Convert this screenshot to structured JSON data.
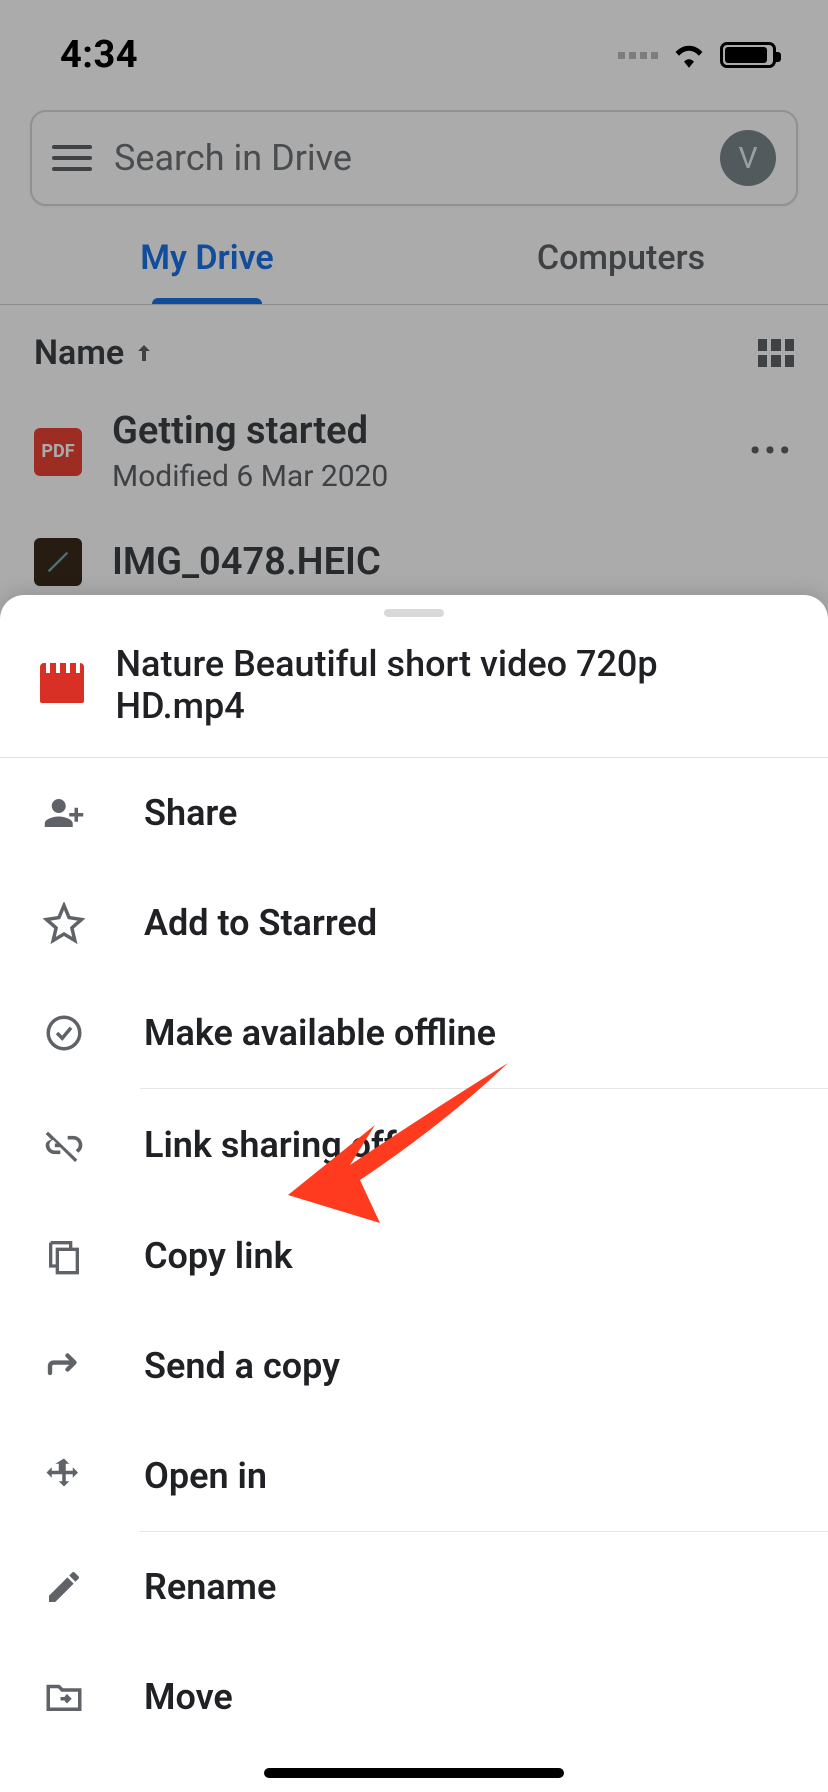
{
  "statusbar": {
    "time": "4:34"
  },
  "search": {
    "placeholder": "Search in Drive",
    "avatar_initial": "V"
  },
  "tabs": {
    "active": "My Drive",
    "inactive": "Computers"
  },
  "sort": {
    "label": "Name"
  },
  "files": [
    {
      "name": "Getting started",
      "sub": "Modified 6 Mar 2020",
      "icon": "PDF"
    },
    {
      "name": "IMG_0478.HEIC",
      "sub": "",
      "icon": "IMG"
    }
  ],
  "sheet": {
    "title": "Nature Beautiful short video 720p HD.mp4",
    "actions": {
      "share": "Share",
      "starred": "Add to Starred",
      "offline": "Make available offline",
      "linksharing": "Link sharing off",
      "copylink": "Copy link",
      "sendcopy": "Send a copy",
      "openin": "Open in",
      "rename": "Rename",
      "move": "Move"
    }
  }
}
